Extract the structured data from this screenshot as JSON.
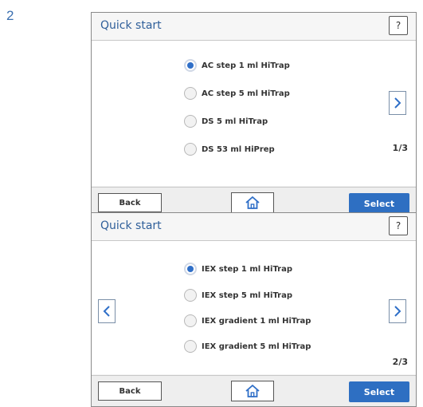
{
  "step_number": "2",
  "colors": {
    "title": "#2f5f9a",
    "accent": "#2e6fc2",
    "radio_selected": "#2f6fc8"
  },
  "screens": [
    {
      "title": "Quick start",
      "help_label": "?",
      "options": [
        {
          "label": "AC step 1 ml HiTrap",
          "selected": true
        },
        {
          "label": "AC step 5 ml HiTrap",
          "selected": false
        },
        {
          "label": "DS 5 ml HiTrap",
          "selected": false
        },
        {
          "label": "DS 53 ml HiPrep",
          "selected": false
        }
      ],
      "page_indicator": "1/3",
      "has_prev": false,
      "has_next": true,
      "back_label": "Back",
      "home_icon": "home-icon",
      "select_label": "Select"
    },
    {
      "title": "Quick start",
      "help_label": "?",
      "options": [
        {
          "label": "IEX step 1 ml HiTrap",
          "selected": true
        },
        {
          "label": "IEX step 5 ml HiTrap",
          "selected": false
        },
        {
          "label": "IEX gradient 1 ml HiTrap",
          "selected": false
        },
        {
          "label": "IEX gradient 5 ml HiTrap",
          "selected": false
        }
      ],
      "page_indicator": "2/3",
      "has_prev": true,
      "has_next": true,
      "back_label": "Back",
      "home_icon": "home-icon",
      "select_label": "Select"
    }
  ]
}
